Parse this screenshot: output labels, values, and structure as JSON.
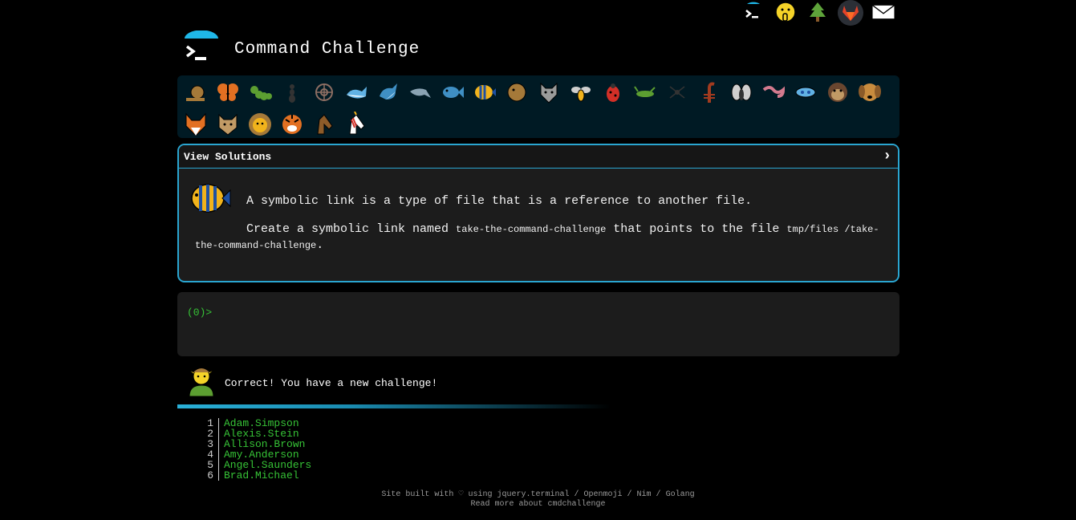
{
  "header": {
    "title": "Command Challenge"
  },
  "top_icons": [
    "terminal-icon",
    "shush-face-icon",
    "tree-icon",
    "gitlab-icon",
    "envelope-icon"
  ],
  "strip_row1": [
    "snail-icon",
    "butterfly-icon",
    "caterpillar-icon",
    "ant-icon",
    "shell-icon",
    "whale-icon",
    "shark-icon",
    "dolphin-icon",
    "fish-icon",
    "tropical-fish-icon",
    "blowfish-icon",
    "wolf-icon",
    "bee-icon",
    "ladybug-icon",
    "cricket-icon",
    "spider-icon",
    "scorpion-icon",
    "fly-icon",
    "worm-icon",
    "microbe-icon",
    "monkey-icon",
    "dog-icon"
  ],
  "strip_row2": [
    "fox-icon",
    "cat-icon",
    "lion-icon",
    "tiger-icon",
    "horse-icon",
    "unicorn-icon"
  ],
  "panel": {
    "head_label": "View Solutions",
    "chevron": "›",
    "line1": "A symbolic link is a type of file that is a reference to another file.",
    "line2_a": "Create a symbolic link named ",
    "code1": "take-the-command-challenge",
    "line2_b": " that points to the file ",
    "code2": "tmp/files /take-the-command-challenge",
    "line2_c": "."
  },
  "terminal": {
    "prompt": "(0)>"
  },
  "success": {
    "message": "Correct! You have a new challenge!"
  },
  "leaderboard": [
    {
      "rank": "1",
      "name": "Adam.Simpson"
    },
    {
      "rank": "2",
      "name": "Alexis.Stein"
    },
    {
      "rank": "3",
      "name": "Allison.Brown"
    },
    {
      "rank": "4",
      "name": "Amy.Anderson"
    },
    {
      "rank": "5",
      "name": "Angel.Saunders"
    },
    {
      "rank": "6",
      "name": "Brad.Michael"
    }
  ],
  "footer": {
    "line1_a": "Site built with ♡ using ",
    "link_jquery": "jquery.terminal",
    "sep": " / ",
    "link_openmoji": "Openmoji",
    "link_nim": "Nim",
    "link_golang": "Golang",
    "line2_a": "Read more about ",
    "link_about": "cmdchallenge"
  },
  "colors": {
    "accent": "#2aa5d0",
    "green": "#36c236",
    "panel": "#1c1c1c",
    "strip": "#001a24"
  }
}
